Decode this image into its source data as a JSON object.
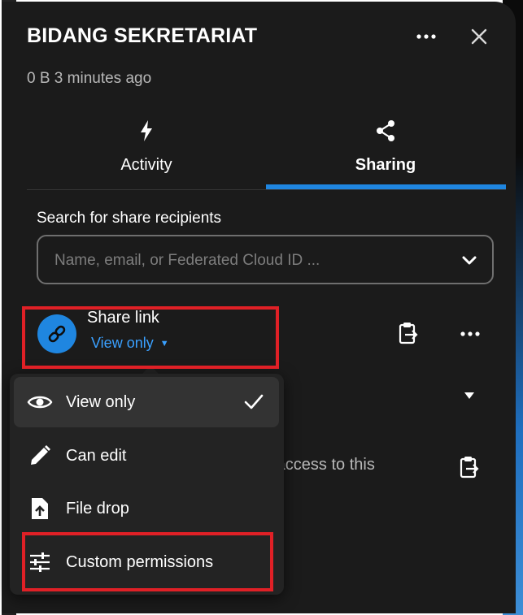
{
  "header": {
    "title": "BIDANG SEKRETARIAT",
    "meta": "0 B 3 minutes ago",
    "more_icon": "more-horizontal-icon",
    "close_icon": "close-icon"
  },
  "tabs": [
    {
      "label": "Activity",
      "icon": "lightning-icon",
      "active": false
    },
    {
      "label": "Sharing",
      "icon": "share-icon",
      "active": true
    }
  ],
  "search": {
    "label": "Search for share recipients",
    "placeholder": "Name, email, or Federated Cloud ID ...",
    "value": ""
  },
  "share_link": {
    "title": "Share link",
    "permission": "View only",
    "icon": "link-icon"
  },
  "background_row": {
    "partial_text": "n access to this"
  },
  "permission_menu": {
    "items": [
      {
        "label": "View only",
        "icon": "eye-icon",
        "selected": true
      },
      {
        "label": "Can edit",
        "icon": "pencil-icon",
        "selected": false
      },
      {
        "label": "File drop",
        "icon": "file-upload-icon",
        "selected": false
      },
      {
        "label": "Custom permissions",
        "icon": "tune-icon",
        "selected": false
      }
    ]
  },
  "colors": {
    "panel_bg": "#1b1b1b",
    "accent": "#1f86e0",
    "highlight_box": "#e02026"
  }
}
